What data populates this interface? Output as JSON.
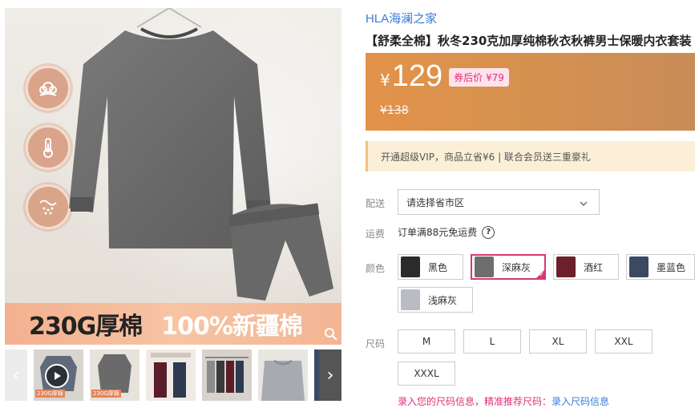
{
  "gallery": {
    "banner_text_1": "230G厚棉",
    "banner_text_2": "100%新疆棉",
    "feature_icons": [
      "cotton-icon",
      "thermometer-icon",
      "fabric-icon"
    ],
    "thumbnails": [
      {
        "name": "thumb-video",
        "pill": "230G厚棉"
      },
      {
        "name": "thumb-dark-gray",
        "pill": "230G厚棉"
      },
      {
        "name": "thumb-couple-colors",
        "pill": ""
      },
      {
        "name": "thumb-color-rack",
        "pill": ""
      },
      {
        "name": "thumb-gray-closeup",
        "pill": ""
      },
      {
        "name": "thumb-navy",
        "pill": ""
      }
    ]
  },
  "product": {
    "brand": "HLA海澜之家",
    "title": "【舒柔全棉】秋冬230克加厚纯棉秋衣秋裤男士保暖内衣套装"
  },
  "price": {
    "currency": "¥",
    "current": "129",
    "coupon": "券后价 ¥79",
    "original": "¥138"
  },
  "vip": {
    "text": "开通超级VIP，商品立省¥6 | 联合会员送三重豪礼"
  },
  "shipping": {
    "label": "配送",
    "placeholder": "请选择省市区",
    "fee_label": "运费",
    "fee_text": "订单满88元免运费"
  },
  "colors": {
    "label": "颜色",
    "selected": "深麻灰",
    "options": [
      {
        "name": "黑色",
        "swatch": "#2b2b2b"
      },
      {
        "name": "深麻灰",
        "swatch": "#6e6e6e"
      },
      {
        "name": "酒红",
        "swatch": "#6e1f2c"
      },
      {
        "name": "墨蓝色",
        "swatch": "#3a4a63"
      },
      {
        "name": "浅麻灰",
        "swatch": "#b9bcc2"
      }
    ]
  },
  "sizes": {
    "label": "尺码",
    "options": [
      "M",
      "L",
      "XL",
      "XXL",
      "XXXL"
    ]
  },
  "size_info": {
    "text": "录入您的尺码信息，精准推荐尺码：",
    "link": "录入尺码信息"
  },
  "theme": {
    "accent": "#d83773",
    "brand_link": "#3a7bd5",
    "price_bg": "#d8924e"
  }
}
